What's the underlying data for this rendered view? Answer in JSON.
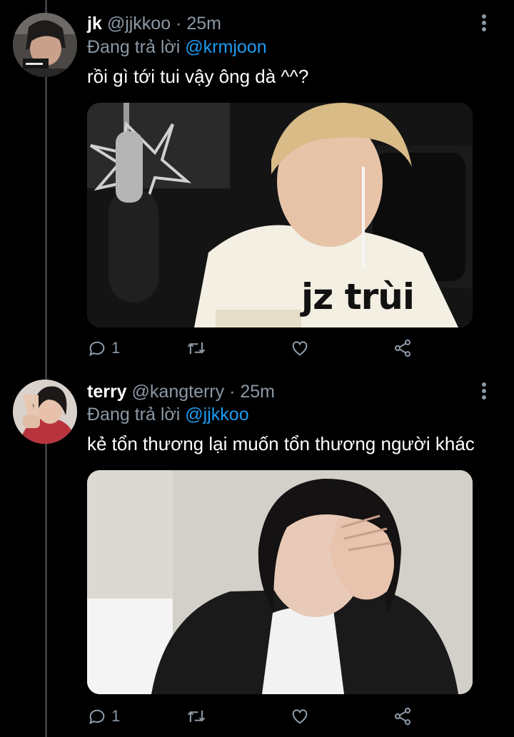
{
  "colors": {
    "background": "#000000",
    "text_primary": "#ffffff",
    "text_secondary": "#8b98a5",
    "link": "#1d9bf0",
    "thread_line": "#3a3d42"
  },
  "tweets": [
    {
      "display_name": "jk",
      "handle": "@jjkkoo",
      "separator": "·",
      "time": "25m",
      "reply_prefix": "Đang trả lời",
      "reply_to": "@krmjoon",
      "text": "rồi gì tới tui vậy ông dà ^^?",
      "media_caption": "jz trùi",
      "reply_count": "1",
      "icons": [
        "reply-icon",
        "retweet-icon",
        "like-icon",
        "share-icon",
        "more-icon"
      ]
    },
    {
      "display_name": "terry",
      "handle": "@kangterry",
      "separator": "·",
      "time": "25m",
      "reply_prefix": "Đang trả lời",
      "reply_to": "@jjkkoo",
      "text": "kẻ tổn thương lại muốn tổn thương người khác",
      "reply_count": "1",
      "icons": [
        "reply-icon",
        "retweet-icon",
        "like-icon",
        "share-icon",
        "more-icon"
      ]
    }
  ]
}
